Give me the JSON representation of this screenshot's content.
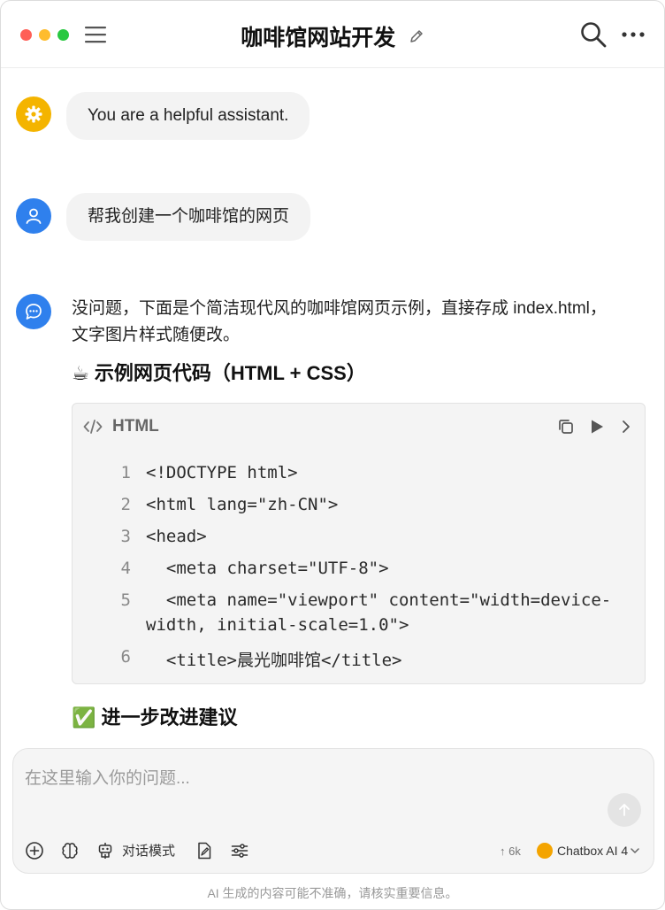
{
  "window": {
    "title": "咖啡馆网站开发"
  },
  "messages": {
    "system": "You are a helpful assistant.",
    "user": "帮我创建一个咖啡馆的网页",
    "assistant_intro_line1": "没问题，下面是个简洁现代风的咖啡馆网页示例，直接存成 index.html，",
    "assistant_intro_line2": "文字图片样式随便改。"
  },
  "sections": {
    "code_heading": "☕ 示例网页代码（HTML + CSS）",
    "next_heading": "✅ 进一步改进建议"
  },
  "code_block": {
    "language": "HTML",
    "lines": [
      {
        "num": "1",
        "code": "<!DOCTYPE html>"
      },
      {
        "num": "2",
        "code": "<html lang=\"zh-CN\">"
      },
      {
        "num": "3",
        "code": "<head>"
      },
      {
        "num": "4",
        "code": "  <meta charset=\"UTF-8\">"
      },
      {
        "num": "5",
        "code": "  <meta name=\"viewport\" content=\"width=device-"
      },
      {
        "num": "",
        "code": "width, initial-scale=1.0\">"
      },
      {
        "num": "6",
        "code": "  <title>晨光咖啡馆</title>"
      }
    ]
  },
  "input": {
    "placeholder": "在这里输入你的问题...",
    "mode_label": "对话模式",
    "token_count": "↑ 6k",
    "model_name": "Chatbox AI 4"
  },
  "footer": {
    "note": "AI 生成的内容可能不准确，请核实重要信息。"
  },
  "colors": {
    "accent_blue": "#2f80ed",
    "system_yellow": "#f4b400"
  }
}
